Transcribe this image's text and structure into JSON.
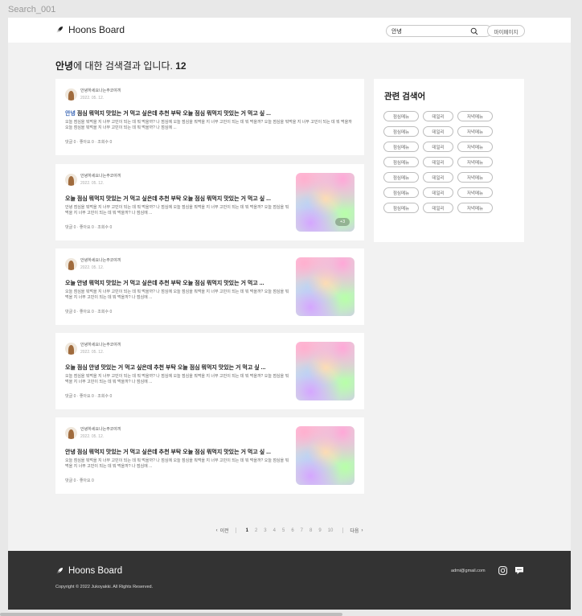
{
  "frame_label": "Search_001",
  "header": {
    "logo_text": "Hoons Board",
    "search_value": "안녕",
    "search_icon": "search-icon",
    "mypage_label": "마이페이지"
  },
  "results": {
    "query": "안녕",
    "suffix": "에 대한 검색결과 입니다.",
    "count": "12"
  },
  "posts": [
    {
      "author": "안녕하세요나는주코야끼",
      "date": "2022. 05. 12.",
      "title_highlight": "안녕",
      "title": " 점심 뭐먹지 맛있는 거 먹고 싶은데 추천 부탁 오늘 점심 뭐먹지 맛있는 거 먹고 싶 ...",
      "body": "오늘 점심을 뭐먹을 지 너무 고민이 되는 데 뭐 먹을까? 나 점심에 오늘 점심을 뭐먹을 지 너무 고민이 되는 데 뭐 먹을까? 오늘 점심을 뭐먹을 지 너무 고민이 되는 데 뭐 먹을까 오늘 점심을 뭐먹을 지 너무 고민이 되는 데 뭐 먹을까? 나 점심에 ...",
      "comments": "댓글 0",
      "likes": "좋아요 0",
      "views": "조회수 0"
    },
    {
      "author": "안녕하세요나는주코야끼",
      "date": "2022. 05. 12.",
      "title": "오늘 점심 뭐먹지 맛있는 거 먹고 싶은데 추천 부탁 오늘 점심 뭐먹지 맛있는 거 먹고 싶 ...",
      "body": "안녕 점심을 뭐먹을 지 너무 고민이 되는 데 뭐 먹을까? 나 점심에 오늘 점심을 뭐먹을 지 너무 고민이 되는 데 뭐 먹을까? 오늘 점심을 뭐먹을 지 너무 고민이 되는 데 뭐 먹을까? 나 점심에 ...",
      "comments": "댓글 0",
      "likes": "좋아요 0",
      "views": "조회수 0",
      "image_badge": "+3"
    },
    {
      "author": "안녕하세요나는주코야끼",
      "date": "2022. 05. 12.",
      "title": "오늘 안녕 뭐먹지 맛있는 거 먹고 싶은데 추천 부탁 오늘 점심 뭐먹지 맛있는 거 먹고 ...",
      "body": "오늘 점심을 뭐먹을 지 너무 고민이 되는 데 뭐 먹을까? 나 점심에 오늘 점심을 뭐먹을 지 너무 고민이 되는 데 뭐 먹을까? 오늘 점심을 뭐먹을 지 너무 고민이 되는 데 뭐 먹을까? 나 점심에 ...",
      "comments": "댓글 0",
      "likes": "좋아요 0",
      "views": "조회수 0"
    },
    {
      "author": "안녕하세요나는주코야끼",
      "date": "2022. 05. 12.",
      "title": "오늘 점심 안녕 맛있는 거 먹고 싶은데 추천 부탁 오늘 점심 뭐먹지 맛있는 거 먹고 싶 ...",
      "body": "오늘 점심을 뭐먹을 지 너무 고민이 되는 데 뭐 먹을까? 나 점심에 오늘 점심을 뭐먹을 지 너무 고민이 되는 데 뭐 먹을까? 오늘 점심을 뭐먹을 지 너무 고민이 되는 데 뭐 먹을까? 나 점심에 ...",
      "comments": "댓글 0",
      "likes": "좋아요 0",
      "views": "조회수 0"
    },
    {
      "author": "안녕하세요나는주코야끼",
      "date": "2022. 05. 12.",
      "title": "안녕 점심 뭐먹지 맛있는 거 먹고 싶은데 추천 부탁 오늘 점심 뭐먹지 맛있는 거 먹고 싶 ...",
      "body": "오늘 점심을 뭐먹을 지 너무 고민이 되는 데 뭐 먹을까? 나 점심에 오늘 점심을 뭐먹을 지 너무 고민이 되는 데 뭐 먹을까? 오늘 점심을 뭐먹을 지 너무 고민이 되는 데 뭐 먹을까? 나 점심에 ...",
      "comments": "댓글 0",
      "likes": "좋아요 0"
    }
  ],
  "related": {
    "title": "관련 검색어",
    "tags": [
      "점심메뉴",
      "데일리",
      "저녁메뉴",
      "점심메뉴",
      "데일리",
      "저녁메뉴",
      "점심메뉴",
      "데일리",
      "저녁메뉴",
      "점심메뉴",
      "데일리",
      "저녁메뉴",
      "점심메뉴",
      "데일리",
      "저녁메뉴",
      "점심메뉴",
      "데일리",
      "저녁메뉴",
      "점심메뉴",
      "데일리",
      "저녁메뉴"
    ]
  },
  "pagination": {
    "prev_label": "이전",
    "next_label": "다음",
    "pages": [
      "1",
      "2",
      "3",
      "4",
      "5",
      "6",
      "7",
      "8",
      "9",
      "10"
    ],
    "current": "1"
  },
  "footer": {
    "logo_text": "Hoons Board",
    "copyright": "Copyright © 2022 Jukoyakki. All Rights Reserved.",
    "email": "admi@gmail.com",
    "icons": [
      "instagram-icon",
      "chat-icon"
    ]
  },
  "colors": {
    "highlight": "#3a66b5",
    "footer_bg": "#333333",
    "page_bg": "#f2f2f2"
  }
}
